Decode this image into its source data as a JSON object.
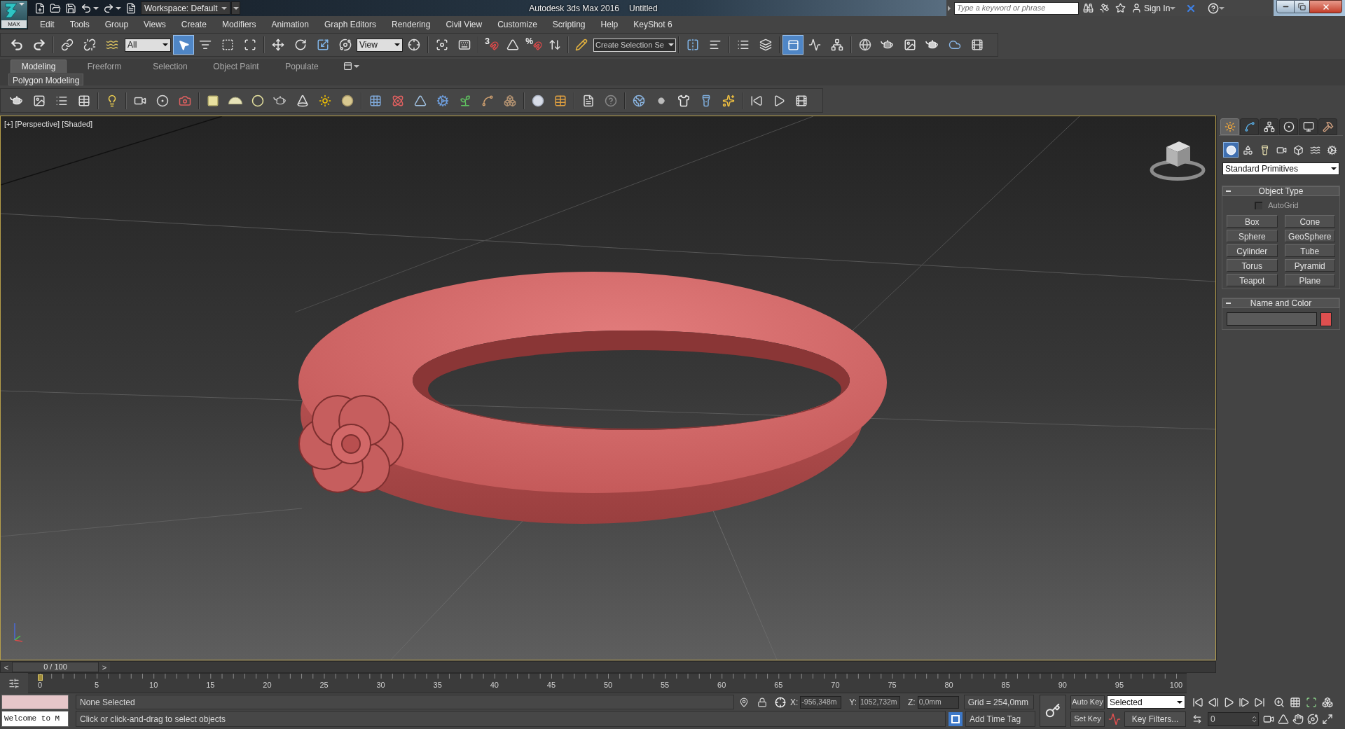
{
  "title_bar": {
    "app_button": "MAX",
    "workspace": "Workspace: Default",
    "title": "Autodesk 3ds Max 2016",
    "document": "Untitled",
    "search": {
      "placeholder": "Type a keyword or phrase"
    },
    "sign_in": "Sign In"
  },
  "menu_bar": [
    "Edit",
    "Tools",
    "Group",
    "Views",
    "Create",
    "Modifiers",
    "Animation",
    "Graph Editors",
    "Rendering",
    "Civil View",
    "Customize",
    "Scripting",
    "Help",
    "KeyShot 6"
  ],
  "main_toolbar": {
    "selection_filter": "All",
    "select_object": {
      "selected": true
    },
    "reference_coordinate_system": "View",
    "snap_toggle": "3",
    "percent_snap": "%",
    "named_selection_set": {
      "placeholder": "Create Selection Se"
    },
    "ribbon_toggle": {
      "selected": true
    }
  },
  "ribbon": {
    "tabs": [
      {
        "label": "Modeling",
        "selected": true
      },
      {
        "label": "Freeform",
        "selected": false
      },
      {
        "label": "Selection",
        "selected": false
      },
      {
        "label": "Object Paint",
        "selected": false
      },
      {
        "label": "Populate",
        "selected": false
      }
    ],
    "panel": "Polygon Modeling"
  },
  "viewport": {
    "labels": [
      "[+]",
      "[Perspective]",
      "[Shaded]"
    ]
  },
  "command_panel": {
    "tabs": [
      {
        "kind": "create",
        "selected": true
      },
      {
        "kind": "modify",
        "selected": false
      },
      {
        "kind": "hierarchy",
        "selected": false
      },
      {
        "kind": "motion",
        "selected": false
      },
      {
        "kind": "display",
        "selected": false
      },
      {
        "kind": "utilities",
        "selected": false
      }
    ],
    "categories": [
      {
        "kind": "geometry",
        "selected": true
      },
      {
        "kind": "shapes",
        "selected": false
      },
      {
        "kind": "lights",
        "selected": false
      },
      {
        "kind": "cameras",
        "selected": false
      },
      {
        "kind": "helpers",
        "selected": false
      },
      {
        "kind": "space_warps",
        "selected": false
      },
      {
        "kind": "systems",
        "selected": false
      }
    ],
    "subcategory": "Standard Primitives",
    "object_type": {
      "title": "Object Type",
      "expanded": true,
      "autogrid": {
        "label": "AutoGrid",
        "checked": false
      },
      "buttons": [
        "Box",
        "Cone",
        "Sphere",
        "GeoSphere",
        "Cylinder",
        "Tube",
        "Torus",
        "Pyramid",
        "Teapot",
        "Plane"
      ]
    },
    "name_and_color": {
      "title": "Name and Color",
      "expanded": true,
      "color": "#dd4f4f"
    }
  },
  "time_slider": {
    "previous": "<",
    "position": "0 / 100",
    "next": ">"
  },
  "track_bar": {
    "ticks": [
      "0",
      "5",
      "10",
      "15",
      "20",
      "25",
      "30",
      "35",
      "40",
      "45",
      "50",
      "55",
      "60",
      "65",
      "70",
      "75",
      "80",
      "85",
      "90",
      "95",
      "100"
    ]
  },
  "status_bar": {
    "listener_output": "Welcome to M",
    "selection": "None Selected",
    "prompt": "Click or click-and-drag to select objects",
    "coordinates": [
      {
        "axis": "X:",
        "value": "-956,348m"
      },
      {
        "axis": "Y:",
        "value": "1052,732m"
      },
      {
        "axis": "Z:",
        "value": "0,0mm"
      }
    ],
    "grid": "Grid = 254,0mm",
    "add_time_tag": "Add Time Tag",
    "auto_key": {
      "label": "Auto Key",
      "on": false
    },
    "key_mode": "Selected",
    "set_key": "Set Key",
    "key_filters": "Key Filters...",
    "current_frame": "0"
  }
}
